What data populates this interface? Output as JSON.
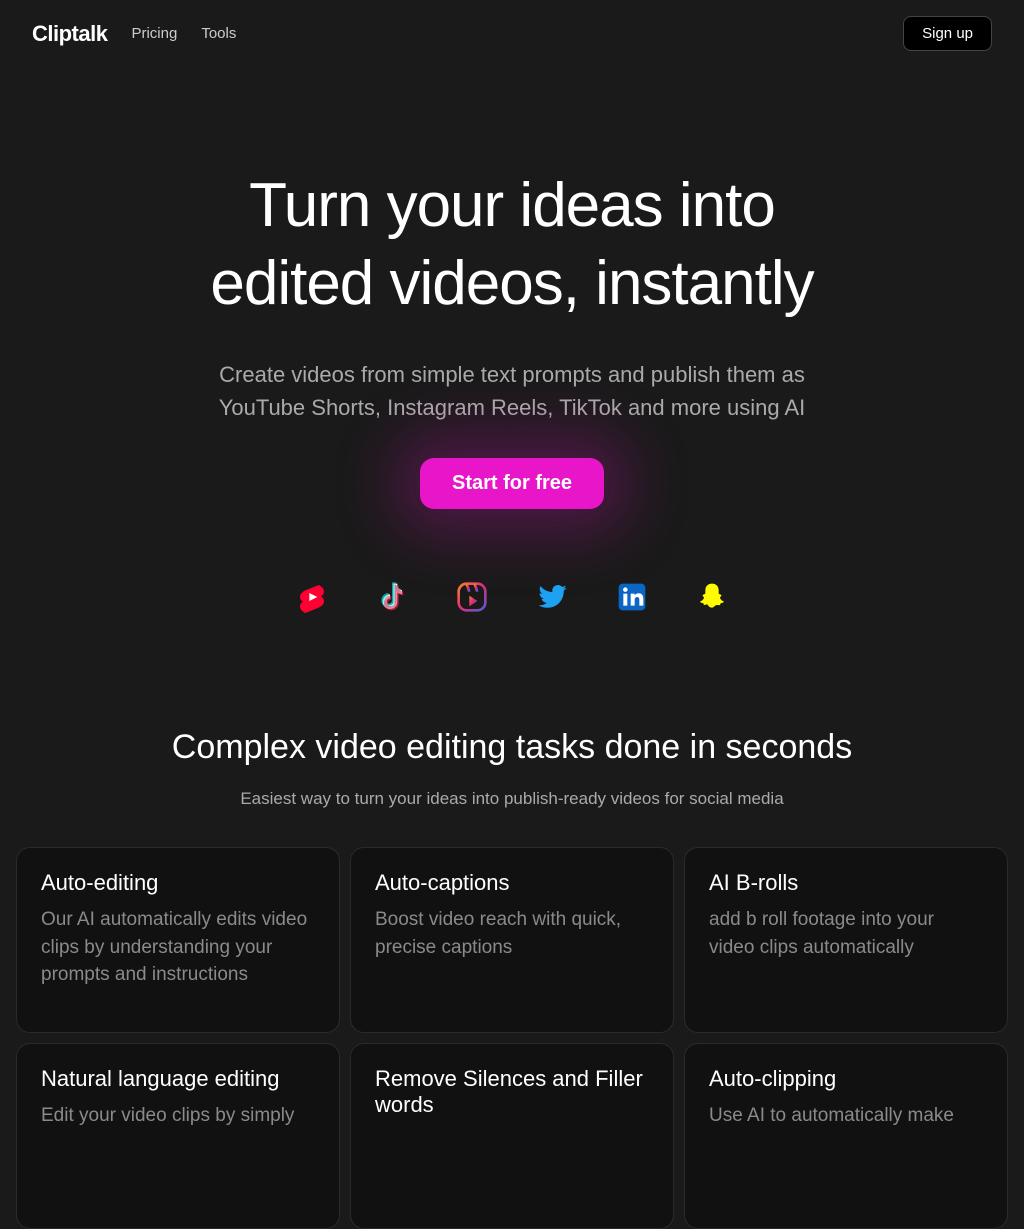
{
  "header": {
    "logo": "Cliptalk",
    "nav": [
      "Pricing",
      "Tools"
    ],
    "signup": "Sign up"
  },
  "hero": {
    "title_line1": "Turn your ideas into",
    "title_line2": "edited videos, instantly",
    "sub_line1": "Create videos from simple text prompts and publish them as",
    "sub_line2": "YouTube Shorts, Instagram Reels, TikTok and more using AI",
    "cta": "Start for free"
  },
  "social_icons": [
    "youtube-shorts",
    "tiktok",
    "instagram-reels",
    "twitter",
    "linkedin",
    "snapchat"
  ],
  "section": {
    "title": "Complex video editing tasks done in seconds",
    "sub": "Easiest way to turn your ideas into publish-ready videos for social media"
  },
  "cards": [
    {
      "title": "Auto-editing",
      "body": "Our AI automatically edits video clips by understanding your prompts and instructions"
    },
    {
      "title": "Auto-captions",
      "body": "Boost video reach with quick, precise captions"
    },
    {
      "title": "AI B-rolls",
      "body": "add b roll footage into your video clips automatically"
    },
    {
      "title": "Natural language editing",
      "body": "Edit your video clips by simply"
    },
    {
      "title": "Remove Silences and Filler words",
      "body": ""
    },
    {
      "title": "Auto-clipping",
      "body": "Use AI to automatically make"
    }
  ]
}
